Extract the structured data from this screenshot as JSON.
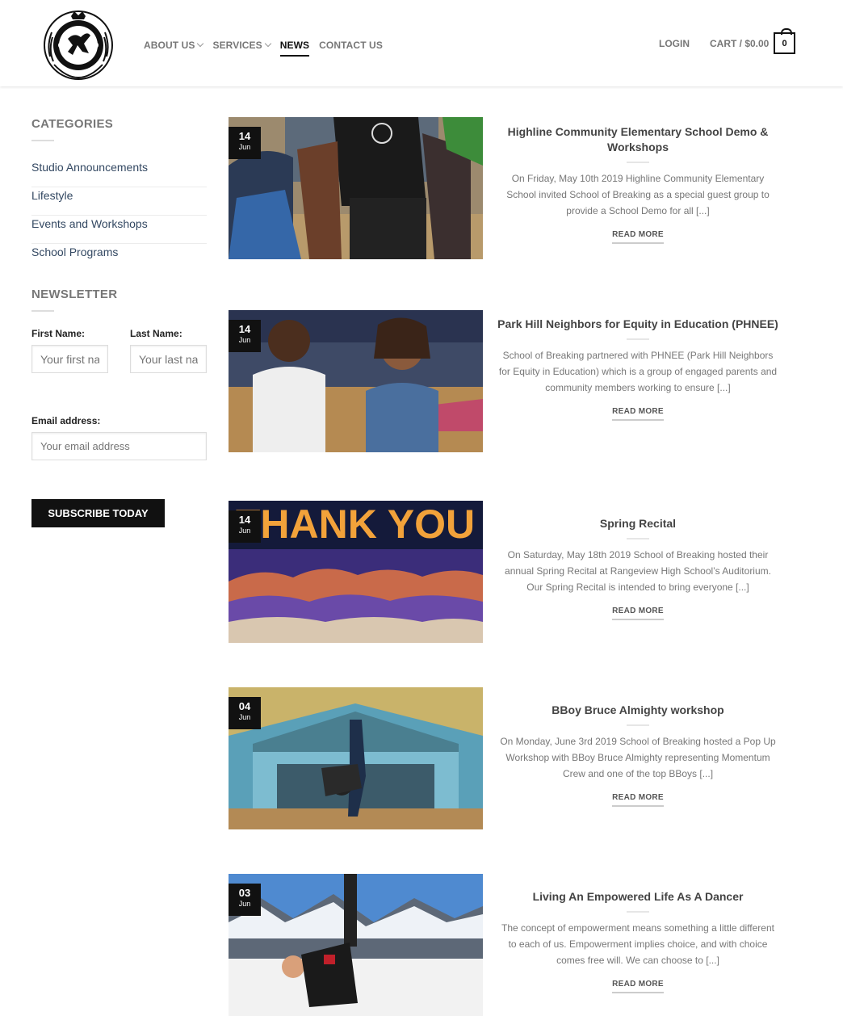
{
  "header": {
    "nav": [
      {
        "label": "ABOUT US",
        "dropdown": true
      },
      {
        "label": "SERVICES",
        "dropdown": true
      },
      {
        "label": "NEWS",
        "active": true
      },
      {
        "label": "CONTACT US"
      }
    ],
    "login": "LOGIN",
    "cart_label": "CART / $0.00",
    "cart_count": "0"
  },
  "sidebar": {
    "categories_title": "CATEGORIES",
    "categories": [
      "Studio Announcements",
      "Lifestyle",
      "Events and Workshops",
      "School Programs"
    ],
    "newsletter_title": "NEWSLETTER",
    "first_name_label": "First Name:",
    "first_name_placeholder": "Your first name",
    "last_name_label": "Last Name:",
    "last_name_placeholder": "Your last name",
    "email_label": "Email address:",
    "email_placeholder": "Your email address",
    "subscribe_label": "SUBSCRIBE TODAY"
  },
  "posts": [
    {
      "day": "14",
      "month": "Jun",
      "title": "Highline Community Elementary School Demo & Workshops",
      "excerpt": "On Friday, May 10th 2019 Highline Community Elementary School invited School of Breaking as a special guest group to provide a School Demo for all [...]",
      "read_more": "READ MORE"
    },
    {
      "day": "14",
      "month": "Jun",
      "title": "Park Hill Neighbors for Equity in Education (PHNEE)",
      "excerpt": "School of Breaking partnered with PHNEE (Park Hill Neighbors for Equity in Education) which is a group of engaged parents and community members working to ensure [...]",
      "read_more": "READ MORE"
    },
    {
      "day": "14",
      "month": "Jun",
      "title": "Spring Recital",
      "excerpt": "On Saturday, May 18th 2019 School of Breaking hosted their annual Spring Recital at Rangeview High School’s Auditorium. Our Spring Recital is intended to bring everyone [...]",
      "read_more": "READ MORE",
      "image_text": "THANK YOU"
    },
    {
      "day": "04",
      "month": "Jun",
      "title": "BBoy Bruce Almighty workshop",
      "excerpt": "On Monday, June 3rd 2019 School of Breaking hosted a Pop Up Workshop with BBoy Bruce Almighty representing Momentum Crew and one of the top BBoys [...]",
      "read_more": "READ MORE"
    },
    {
      "day": "03",
      "month": "Jun",
      "title": "Living An Empowered Life As A Dancer",
      "excerpt": "The concept of empowerment means something a little different to each of us. Empowerment implies choice, and with choice comes free will.  We can choose to [...]",
      "read_more": "READ MORE"
    }
  ]
}
